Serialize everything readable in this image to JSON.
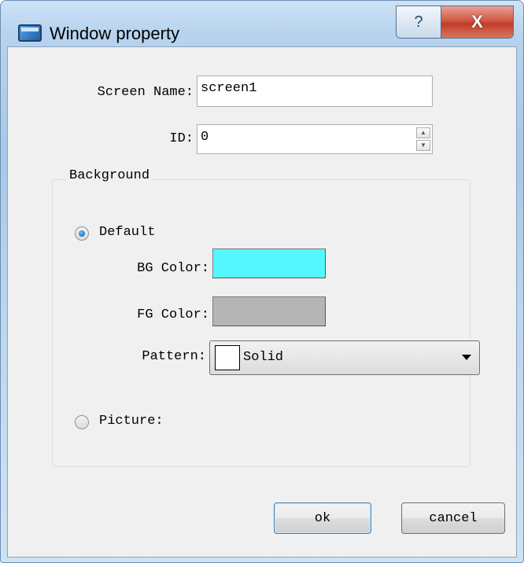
{
  "window": {
    "title": "Window property",
    "help_button": "?",
    "close_button": "X"
  },
  "form": {
    "screen_name_label": "Screen Name:",
    "screen_name_value": "screen1",
    "id_label": "ID:",
    "id_value": "0",
    "spin_up": "▲",
    "spin_down": "▼"
  },
  "background": {
    "group_label": "Background",
    "default_label": "Default",
    "default_selected": true,
    "bg_color_label": "BG Color:",
    "bg_color": "#55f7ff",
    "fg_color_label": "FG Color:",
    "fg_color": "#b5b5b5",
    "pattern_label": "Pattern:",
    "pattern_value": "Solid",
    "picture_label": "Picture:",
    "picture_selected": false
  },
  "buttons": {
    "ok": "ok",
    "cancel": "cancel"
  },
  "icons": [
    "window-app-icon",
    "help-icon",
    "close-icon",
    "spin-up-icon",
    "spin-down-icon",
    "dropdown-arrow-icon"
  ]
}
